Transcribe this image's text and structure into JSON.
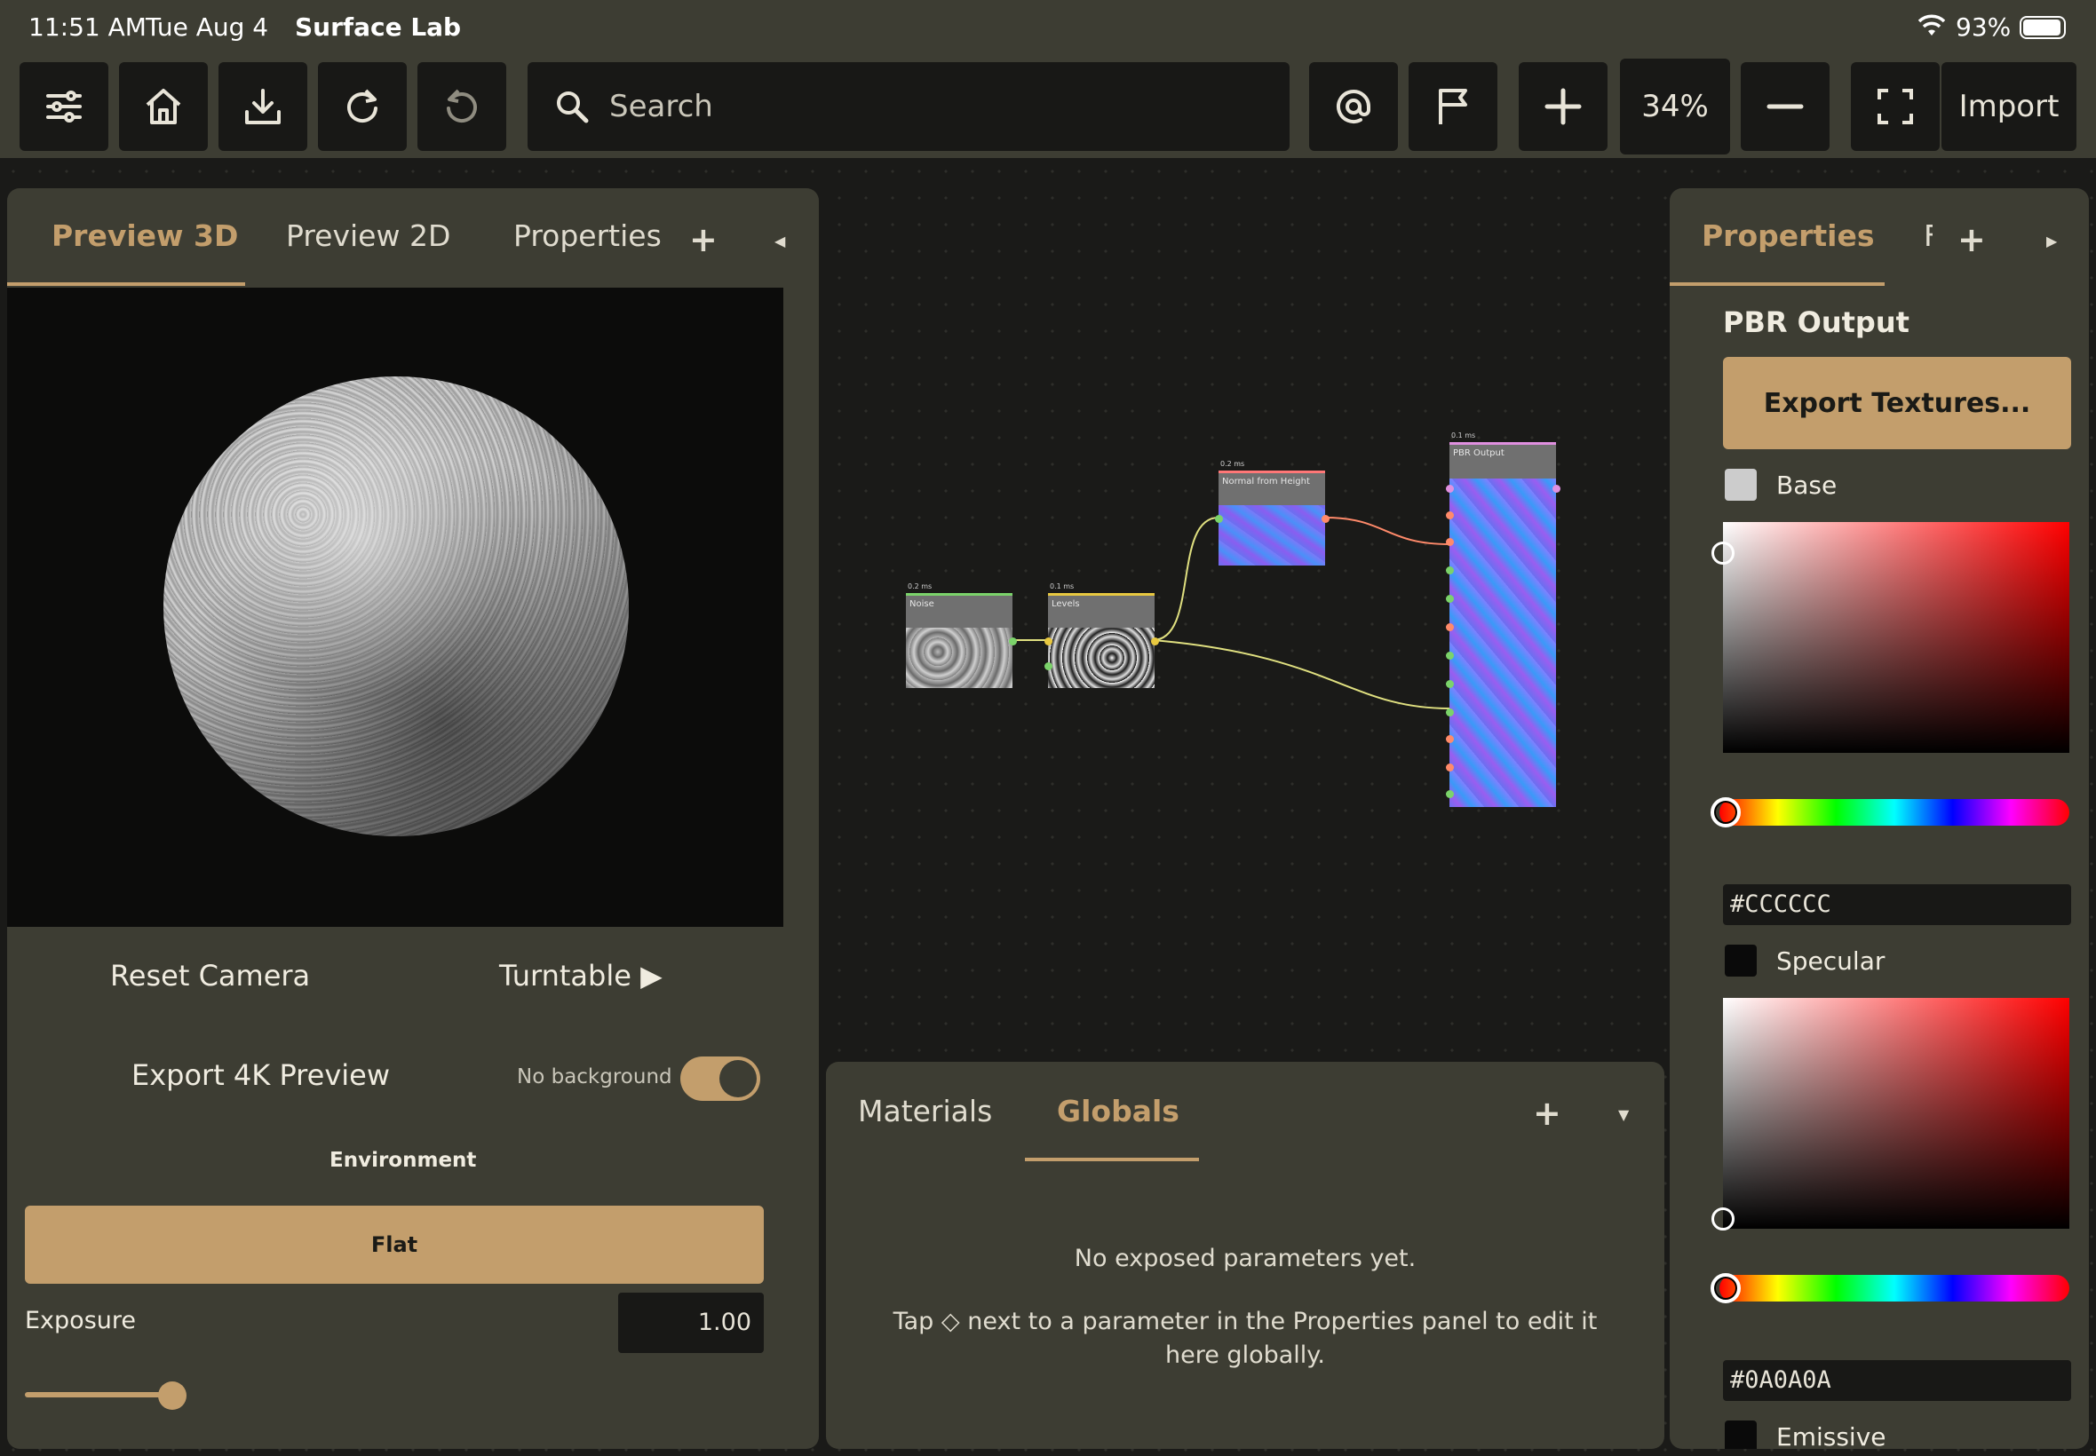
{
  "status_bar": {
    "time": "11:51 AM",
    "date": "Tue Aug 4",
    "app_name": "Surface Lab",
    "battery": "93%"
  },
  "toolbar": {
    "search_placeholder": "Search",
    "zoom": "34%",
    "import_label": "Import",
    "icons": [
      "menu-icon",
      "home-icon",
      "download-icon",
      "redo-icon",
      "undo-icon",
      "at-icon",
      "flag-icon",
      "plus-icon",
      "minus-icon",
      "fullscreen-icon"
    ]
  },
  "left_panel": {
    "tabs": [
      "Preview 3D",
      "Preview 2D",
      "Properties"
    ],
    "active_tab": "Preview 3D",
    "reset_camera": "Reset Camera",
    "turntable": "Turntable ▶",
    "export_preview": "Export 4K Preview",
    "no_background": "No background",
    "no_background_on": true,
    "environment_label": "Environment",
    "environment_value": "Flat",
    "exposure_label": "Exposure",
    "exposure_value": "1.00"
  },
  "graph": {
    "nodes": [
      {
        "title": "Noise",
        "time": "0.2 ms"
      },
      {
        "title": "Levels",
        "time": "0.1 ms"
      },
      {
        "title": "Normal from Height",
        "time": "0.2 ms"
      },
      {
        "title": "PBR Output",
        "time": "0.1 ms"
      }
    ]
  },
  "bottom_panel": {
    "tabs": [
      "Materials",
      "Globals"
    ],
    "active_tab": "Globals",
    "empty_title": "No exposed parameters yet.",
    "empty_hint": "Tap ◇ next to a parameter in the Properties panel to edit it here globally."
  },
  "right_panel": {
    "tabs": [
      "Properties",
      "F"
    ],
    "active_tab": "Properties",
    "node_title": "PBR Output",
    "export_textures": "Export Textures...",
    "channels": [
      {
        "label": "Base",
        "hex": "#CCCCCC",
        "swatch": "#cccccc"
      },
      {
        "label": "Specular",
        "hex": "#0A0A0A",
        "swatch": "#0a0a0a"
      },
      {
        "label": "Emissive",
        "swatch": "#0a0a0a"
      }
    ]
  },
  "colors": {
    "accent": "#c39e6c",
    "panel": "#3d3d33",
    "field": "#181816"
  }
}
